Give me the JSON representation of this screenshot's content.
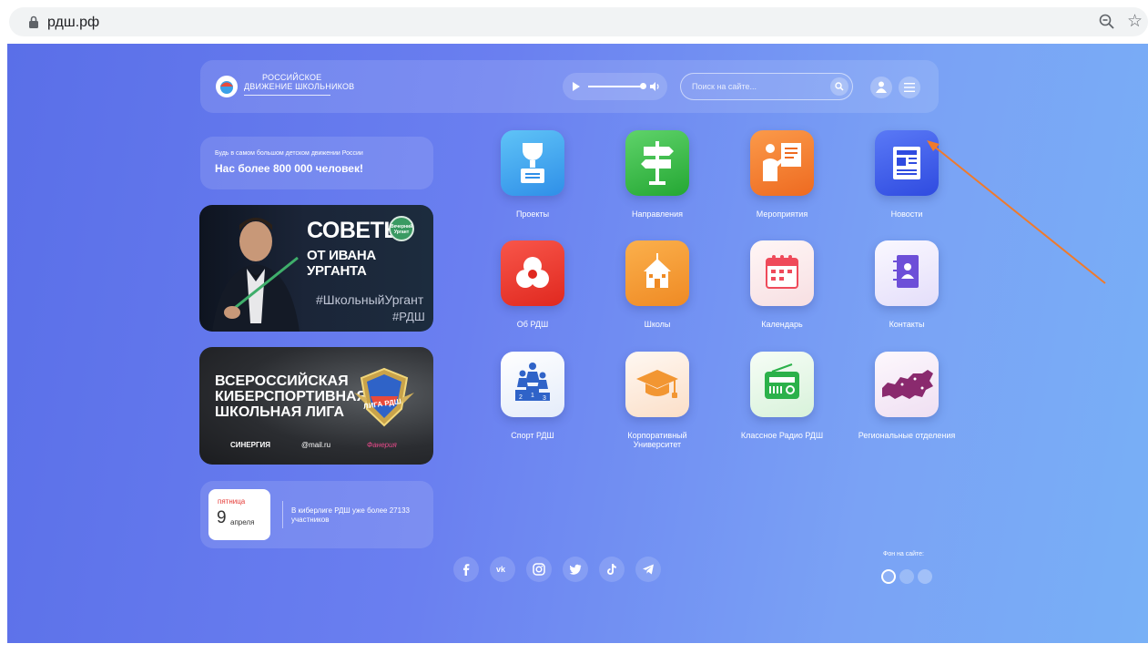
{
  "browser": {
    "url": "рдш.рф",
    "lock_icon": "lock-icon",
    "zoom_icon": "zoom-out-icon",
    "bookmark_icon": "star-icon",
    "bookmark_glyph": "☆"
  },
  "header": {
    "logo_line1": "Российское",
    "logo_line2": "Движение школьников",
    "search_placeholder": "Поиск на сайте..."
  },
  "promo": {
    "small": "Будь в самом большом детском движении России",
    "big": "Нас более 800 000 человек!"
  },
  "banner1": {
    "title1": "СОВЕТЫ",
    "title2": "ОТ ИВАНА УРГАНТА",
    "hashtag1": "#ШкольныйУргант",
    "hashtag2": "#РДШ",
    "badge": "Вечерний Ургант"
  },
  "banner2": {
    "title_lines": [
      "Всероссийская",
      "киберспортивная",
      "школьная лига"
    ],
    "emblem_text": "ЛИГА РДШ",
    "sponsor1": "СИНЕРГИЯ",
    "sponsor2": "@mail.ru",
    "sponsor3": "Фанерия"
  },
  "date_card": {
    "weekday": "пятница",
    "day": "9",
    "month": "апреля",
    "text": "В киберлиге РДШ уже более 27133 участников"
  },
  "tiles": [
    {
      "label": "Проекты",
      "icon": "trophy-icon",
      "color": "#3aa8f0"
    },
    {
      "label": "Направления",
      "icon": "signpost-icon",
      "color": "#3bbd48"
    },
    {
      "label": "Мероприятия",
      "icon": "presentation-icon",
      "color": "#f47a2c"
    },
    {
      "label": "Новости",
      "icon": "newspaper-icon",
      "color": "#3d5ef0"
    },
    {
      "label": "Об РДШ",
      "icon": "rdsh-logo-icon",
      "color": "#ee3c2f"
    },
    {
      "label": "Школы",
      "icon": "school-icon",
      "color": "#f29632"
    },
    {
      "label": "Календарь",
      "icon": "calendar-icon",
      "color": "#fbeeef"
    },
    {
      "label": "Контакты",
      "icon": "contacts-book-icon",
      "color": "#eeeafc"
    },
    {
      "label": "Спорт РДШ",
      "icon": "podium-icon",
      "color": "#eef3fb"
    },
    {
      "label": "Корпоративный Университет",
      "icon": "graduation-cap-icon",
      "color": "#fbeee4"
    },
    {
      "label": "Классное Радио РДШ",
      "icon": "radio-icon",
      "color": "#e9f8ea"
    },
    {
      "label": "Региональные отделения",
      "icon": "russia-map-icon",
      "color": "#f6eef8"
    }
  ],
  "socials": [
    "facebook-icon",
    "vk-icon",
    "instagram-icon",
    "twitter-icon",
    "tiktok-icon",
    "telegram-icon"
  ],
  "background_picker": {
    "label": "Фон на сайте:",
    "options": [
      "light",
      "blue",
      "lightblue"
    ]
  },
  "colors": {
    "accent_arrow": "#f07a2a",
    "bg_gradient_start": "#5a6fe8",
    "bg_gradient_end": "#78b0f6"
  }
}
